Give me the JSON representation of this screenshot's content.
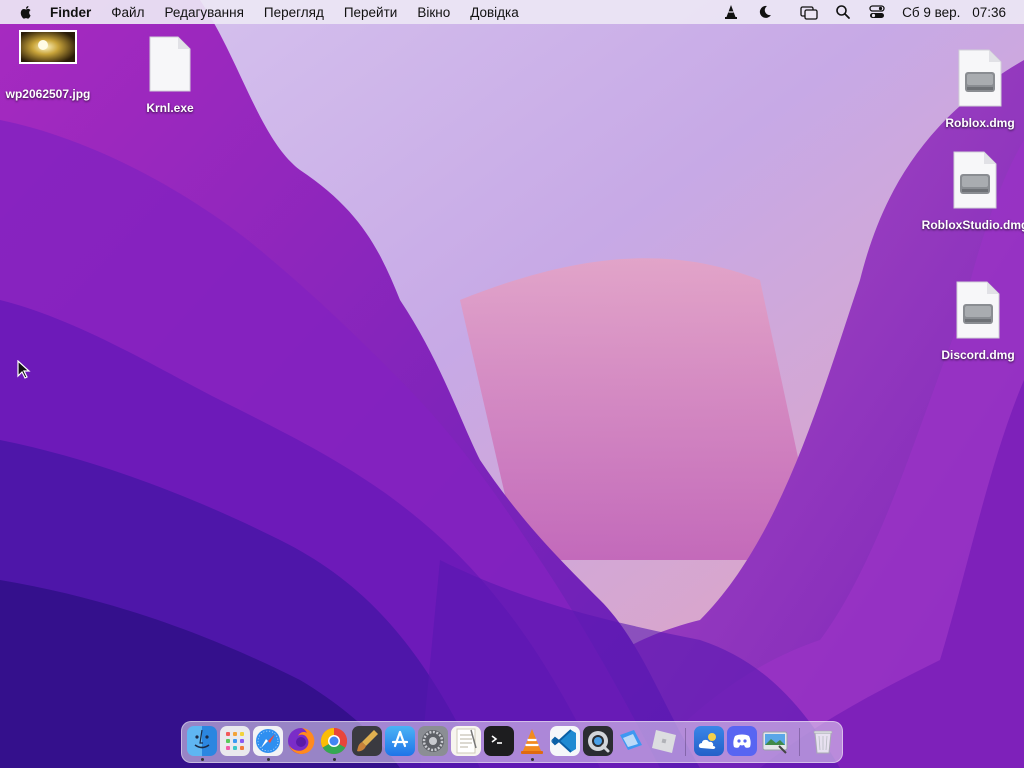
{
  "menubar": {
    "app_name": "Finder",
    "menus": [
      "Файл",
      "Редагування",
      "Перегляд",
      "Перейти",
      "Вікно",
      "Довідка"
    ],
    "status_icons": [
      "vlc-icon",
      "moon-icon",
      "screen-mirroring-icon",
      "search-icon",
      "control-center-icon"
    ],
    "date": "Сб 9 вер.",
    "time": "07:36"
  },
  "desktop": {
    "items": [
      {
        "label": "wp2062507.jpg",
        "icon": "image-thumbnail-icon"
      },
      {
        "label": "Krnl.exe",
        "icon": "document-icon"
      },
      {
        "label": "Roblox.dmg",
        "icon": "disk-image-icon"
      },
      {
        "label": "RobloxStudio.dmg",
        "icon": "disk-image-icon"
      },
      {
        "label": "Discord.dmg",
        "icon": "disk-image-icon"
      }
    ]
  },
  "dock": {
    "apps": [
      {
        "name": "finder-icon",
        "running": true
      },
      {
        "name": "launchpad-icon",
        "running": false
      },
      {
        "name": "safari-icon",
        "running": true
      },
      {
        "name": "firefox-icon",
        "running": false
      },
      {
        "name": "chrome-icon",
        "running": true
      },
      {
        "name": "sketch-brush-icon",
        "running": false
      },
      {
        "name": "app-store-icon",
        "running": false
      },
      {
        "name": "system-preferences-icon",
        "running": false
      },
      {
        "name": "textedit-icon",
        "running": false
      },
      {
        "name": "terminal-icon",
        "running": false
      },
      {
        "name": "vlc-icon",
        "running": true
      },
      {
        "name": "vscode-icon",
        "running": false
      },
      {
        "name": "quicktime-icon",
        "running": false
      },
      {
        "name": "roblox-studio-icon",
        "running": false
      },
      {
        "name": "roblox-icon",
        "running": false
      },
      {
        "name": "weather-icon",
        "running": false
      },
      {
        "name": "discord-icon",
        "running": false
      },
      {
        "name": "preview-icon",
        "running": false
      },
      {
        "name": "trash-icon",
        "running": false
      }
    ]
  },
  "colors": {
    "wallpaper_light": "#c9b3e8",
    "wallpaper_mid": "#9a2bc4",
    "wallpaper_dark": "#3a14a0",
    "menubar_bg": "#ece6f4"
  }
}
